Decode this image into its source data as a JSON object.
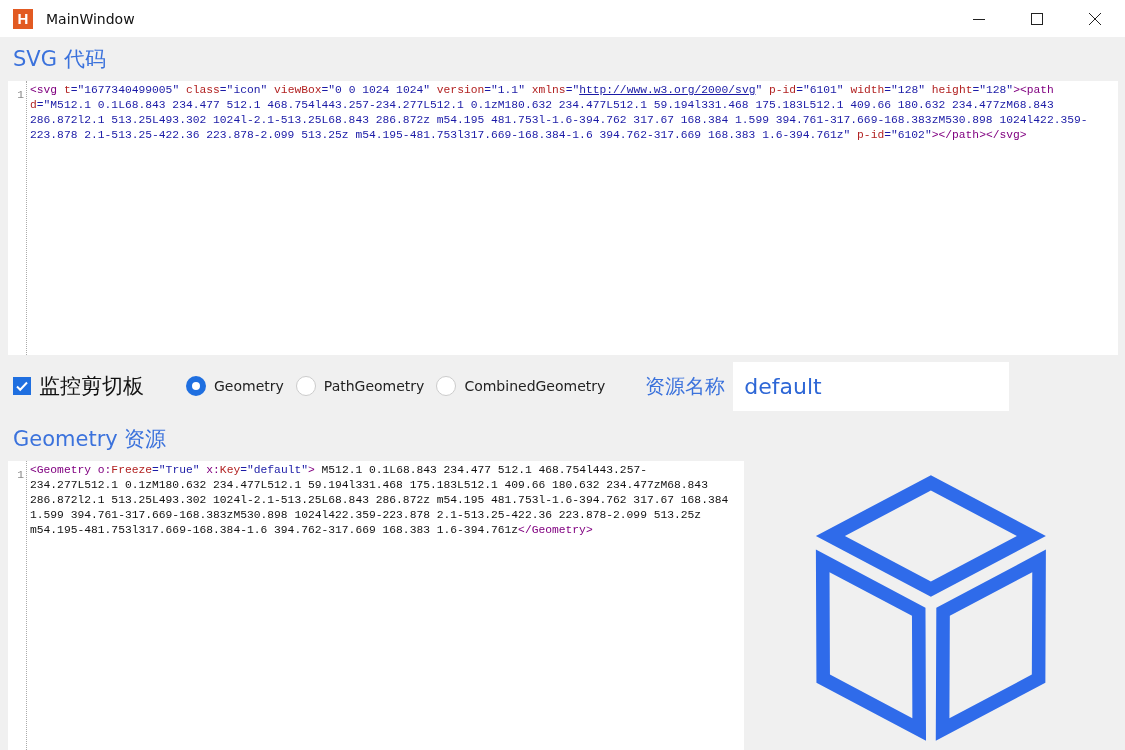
{
  "window": {
    "app_icon_letter": "H",
    "title": "MainWindow"
  },
  "svg_section": {
    "heading": "SVG 代码",
    "editor": {
      "line_number": "1",
      "tokens": [
        {
          "kind": "tag",
          "text": "<svg"
        },
        {
          "kind": "attr",
          "text": " t"
        },
        {
          "kind": "value",
          "text": "=\"1677340499005\""
        },
        {
          "kind": "attr",
          "text": " class"
        },
        {
          "kind": "value",
          "text": "=\"icon\""
        },
        {
          "kind": "attr",
          "text": " viewBox"
        },
        {
          "kind": "value",
          "text": "=\"0 0 1024 1024\""
        },
        {
          "kind": "attr",
          "text": " version"
        },
        {
          "kind": "value",
          "text": "=\"1.1\""
        },
        {
          "kind": "attr",
          "text": " xmlns"
        },
        {
          "kind": "value",
          "text": "=\""
        },
        {
          "kind": "link",
          "text": "http://www.w3.org/2000/svg"
        },
        {
          "kind": "value",
          "text": "\""
        },
        {
          "kind": "attr",
          "text": " p-id"
        },
        {
          "kind": "value",
          "text": "=\"6101\""
        },
        {
          "kind": "attr",
          "text": " width"
        },
        {
          "kind": "value",
          "text": "=\"128\""
        },
        {
          "kind": "attr",
          "text": " height"
        },
        {
          "kind": "value",
          "text": "=\"128\""
        },
        {
          "kind": "tag",
          "text": "><path"
        },
        {
          "kind": "attr",
          "text": " d"
        },
        {
          "kind": "value",
          "text": "=\"M512.1 0.1L68.843 234.477 512.1 468.754l443.257-234.277L512.1 0.1zM180.632 234.477L512.1 59.194l331.468 175.183L512.1 409.66 180.632 234.477zM68.843 286.872l2.1 513.25L493.302 1024l-2.1-513.25L68.843 286.872z m54.195 481.753l-1.6-394.762 317.67 168.384 1.599 394.761-317.669-168.383zM530.898 1024l422.359-223.878 2.1-513.25-422.36 223.878-2.099 513.25z m54.195-481.753l317.669-168.384-1.6 394.762-317.669 168.383 1.6-394.761z\""
        },
        {
          "kind": "attr",
          "text": " p-id"
        },
        {
          "kind": "value",
          "text": "=\"6102\""
        },
        {
          "kind": "tag",
          "text": "></path></svg>"
        }
      ]
    }
  },
  "options": {
    "monitor_clipboard": {
      "label": "监控剪切板",
      "checked": true
    },
    "geometry_types": [
      {
        "label": "Geometry",
        "selected": true
      },
      {
        "label": "PathGeometry",
        "selected": false
      },
      {
        "label": "CombinedGeometry",
        "selected": false
      }
    ],
    "resource_name_label": "资源名称",
    "resource_name_value": "default"
  },
  "geometry_section": {
    "heading": "Geometry 资源",
    "editor": {
      "line_number": "1",
      "tokens": [
        {
          "kind": "tag",
          "text": "<Geometry"
        },
        {
          "kind": "tag",
          "text": " o:"
        },
        {
          "kind": "attr",
          "text": "Freeze"
        },
        {
          "kind": "value",
          "text": "=\"True\""
        },
        {
          "kind": "tag",
          "text": " x:"
        },
        {
          "kind": "attr",
          "text": "Key"
        },
        {
          "kind": "value",
          "text": "=\"default\""
        },
        {
          "kind": "tag",
          "text": ">"
        },
        {
          "kind": "text",
          "text": " M512.1 0.1L68.843 234.477 512.1 468.754l443.257-234.277L512.1 0.1zM180.632 234.477L512.1 59.194l331.468 175.183L512.1 409.66 180.632 234.477zM68.843 286.872l2.1 513.25L493.302 1024l-2.1-513.25L68.843 286.872z m54.195 481.753l-1.6-394.762 317.67 168.384 1.599 394.761-317.669-168.383zM530.898 1024l422.359-223.878 2.1-513.25-422.36 223.878-2.099 513.25z m54.195-481.753l317.669-168.384-1.6 394.762-317.669 168.383 1.6-394.761z"
        },
        {
          "kind": "tag",
          "text": "</Geometry>"
        }
      ]
    }
  }
}
